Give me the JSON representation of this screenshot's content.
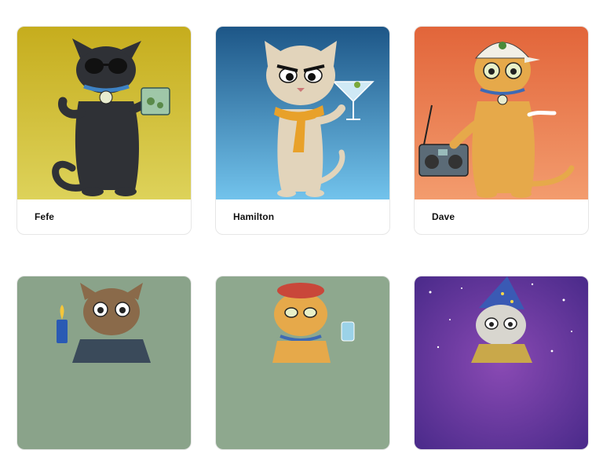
{
  "cards": [
    {
      "name": "Fefe",
      "bg_top": "#c9b21f",
      "bg_bottom": "#d8cc52",
      "cat_color": "#2f3136",
      "accessory": "sunglasses"
    },
    {
      "name": "Hamilton",
      "bg_top": "#1f5a8a",
      "bg_bottom": "#6ec0ea",
      "cat_color": "#e2d4bb",
      "accessory": "martini"
    },
    {
      "name": "Dave",
      "bg_top": "#e26a3c",
      "bg_bottom": "#f29a6a",
      "cat_color": "#e6a94a",
      "accessory": "boombox"
    },
    {
      "name": "",
      "bg_top": "#8ea58e",
      "bg_bottom": "#8aa08a",
      "cat_color": "#8a6a4a",
      "accessory": "lighter"
    },
    {
      "name": "",
      "bg_top": "#8fa88f",
      "bg_bottom": "#8fa88f",
      "cat_color": "#e6a94a",
      "accessory": "beret"
    },
    {
      "name": "",
      "bg_top": "#5a2a8a",
      "bg_bottom": "#7b3ea8",
      "cat_color": "#d8d6cf",
      "accessory": "wizard-hat"
    }
  ]
}
